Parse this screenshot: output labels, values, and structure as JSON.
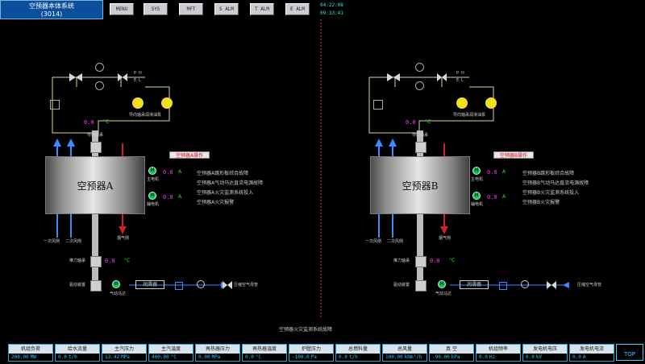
{
  "header": {
    "title": "空预器本体系统",
    "subtitle": "(3014)",
    "nav": [
      "MENU",
      "SYS",
      "MFT",
      "S ALM",
      "T ALM",
      "E ALM"
    ],
    "time": "04:22:08",
    "time2": "09:33:41"
  },
  "units": [
    {
      "rotor_label": "空预器A",
      "operate_label": "空预器A操作",
      "main_motor_label": "主电机",
      "aux_motor_label": "辅电机",
      "main_motor_value": "0.0",
      "main_motor_unit": "A",
      "aux_motor_value": "0.0",
      "aux_motor_unit": "A",
      "alarms": [
        "空预器A跳形板综合故障",
        "空预器A气动马达直流电源故障",
        "空预器A火灾监测系统投入",
        "空预器A火灾报警"
      ],
      "guide_bearing_label": "导向轴承",
      "guide_temp": "0.0",
      "temp_unit": "°C",
      "support_bearing_label": "推力轴承",
      "support_temp": "0.0",
      "lube_pump_label": "导向轴承润滑油泵",
      "primary_air_label": "一次风侧",
      "secondary_air_label": "二次风侧",
      "flue_gas_label": "烟气侧",
      "drive_label": "驱动装置",
      "air_motor_label": "气动马达",
      "filter_label": "润滑器",
      "air_supply_label": "压缩空气母管"
    },
    {
      "rotor_label": "空预器B",
      "operate_label": "空预器B操作",
      "main_motor_label": "主电机",
      "aux_motor_label": "辅电机",
      "main_motor_value": "0.0",
      "main_motor_unit": "A",
      "aux_motor_value": "0.0",
      "aux_motor_unit": "A",
      "alarms": [
        "空预器B跳形板综合故障",
        "空预器B气动马达直流电源故障",
        "空预器B火灾监测系统投入",
        "空预器B火灾报警"
      ],
      "guide_bearing_label": "导向轴承",
      "guide_temp": "0.0",
      "temp_unit": "°C",
      "support_bearing_label": "推力轴承",
      "support_temp": "0.0",
      "lube_pump_label": "导向轴承润滑油泵",
      "primary_air_label": "一次风侧",
      "secondary_air_label": "二次风侧",
      "flue_gas_label": "烟气侧",
      "drive_label": "驱动装置",
      "air_motor_label": "气动马达",
      "filter_label": "润滑器",
      "air_supply_label": "压缩空气母管"
    }
  ],
  "pump_letters": [
    "P",
    "H",
    "E",
    "L"
  ],
  "motor_letter": "M",
  "fire_note": "空预器火灾监测系统故障",
  "status_bar": [
    {
      "label": "机组负荷",
      "value": "200.00",
      "unit": "MW"
    },
    {
      "label": "给水流量",
      "value": "0.0",
      "unit": "t/h"
    },
    {
      "label": "主汽压力",
      "value": "13.42",
      "unit": "MPa"
    },
    {
      "label": "主汽温度",
      "value": "400.00",
      "unit": "°C"
    },
    {
      "label": "再热器压力",
      "value": "0.00",
      "unit": "MPa"
    },
    {
      "label": "再热器温度",
      "value": "0.0",
      "unit": "°C"
    },
    {
      "label": "炉膛压力",
      "value": "-100.0",
      "unit": "Pa"
    },
    {
      "label": "总燃料量",
      "value": "0.0",
      "unit": "t/h"
    },
    {
      "label": "总风量",
      "value": "100.00",
      "unit": "kNm³/h"
    },
    {
      "label": "真 空",
      "value": "-90.00",
      "unit": "kPa"
    },
    {
      "label": "机组频率",
      "value": "0.0",
      "unit": "Hz"
    },
    {
      "label": "发电机电压",
      "value": "0.0",
      "unit": "kV"
    },
    {
      "label": "发电机电流",
      "value": "0.0",
      "unit": "A"
    }
  ],
  "top_button": "TOP",
  "colors": {
    "air": "#3a8cff",
    "flue": "#d02030",
    "accent": "#34e534",
    "value": "#ff3cff"
  }
}
